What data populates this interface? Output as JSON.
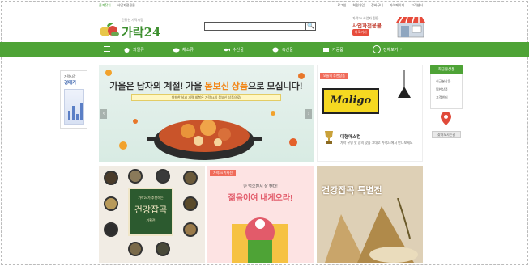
{
  "topbar": {
    "left": [
      "즐겨찾기",
      "사업자전용몰"
    ],
    "right": [
      "로그인",
      "회원가입",
      "장바구니",
      "마이페이지",
      "고객센터"
    ]
  },
  "logo": {
    "tagline": "건강한 가락시장",
    "name": "가락24"
  },
  "search": {
    "placeholder": "",
    "icon": "search-icon"
  },
  "promo": {
    "line1": "가락24 사업자 전용",
    "line2": "사업자전용몰",
    "button": "바로가기"
  },
  "nav": {
    "items": [
      {
        "label": "과일류",
        "icon": "apple-icon"
      },
      {
        "label": "채소류",
        "icon": "vegetable-icon"
      },
      {
        "label": "수산물",
        "icon": "fish-icon"
      },
      {
        "label": "축산물",
        "icon": "meat-icon"
      },
      {
        "label": "가공품",
        "icon": "box-icon"
      }
    ],
    "all_categories": "전체보기"
  },
  "side_left": {
    "line1": "가락시장",
    "line2": "경매가"
  },
  "side_right": {
    "header": "최근본상품",
    "items": [
      "최근본상품",
      "찜한상품",
      "고객센터"
    ],
    "button": "찾아오시는길"
  },
  "banner": {
    "headline_pre": "가을은 남자의 계절! 가을 ",
    "headline_highlight": "몸보신 상품",
    "headline_post": "으로 모십니다!",
    "subline": "쌀쌀한 날씨 기력 회복은 가락24의 몸보신 상품으로!",
    "prev": "‹",
    "next": "›"
  },
  "card1": {
    "caption": "오늘의 추천상품",
    "sign": "Maligo",
    "title": "대형매스컴",
    "desc": "가락 유명 맛 집의 맛을 그대로 가락24에서 만나보세요"
  },
  "tile_a": {
    "small": "가락24가 추천하는",
    "large": "건강잡곡",
    "extra": "기획전"
  },
  "tile_b": {
    "caption": "가락24 기획전",
    "line1": "난 먹으면서 살 뺀다!",
    "line2": "젊음이여 내게오라!"
  },
  "tile_c": {
    "title": "건강잡곡 특별전"
  },
  "colors": {
    "brand_green": "#4ea336",
    "accent_orange": "#f28a1e",
    "accent_red": "#f06b5a"
  }
}
